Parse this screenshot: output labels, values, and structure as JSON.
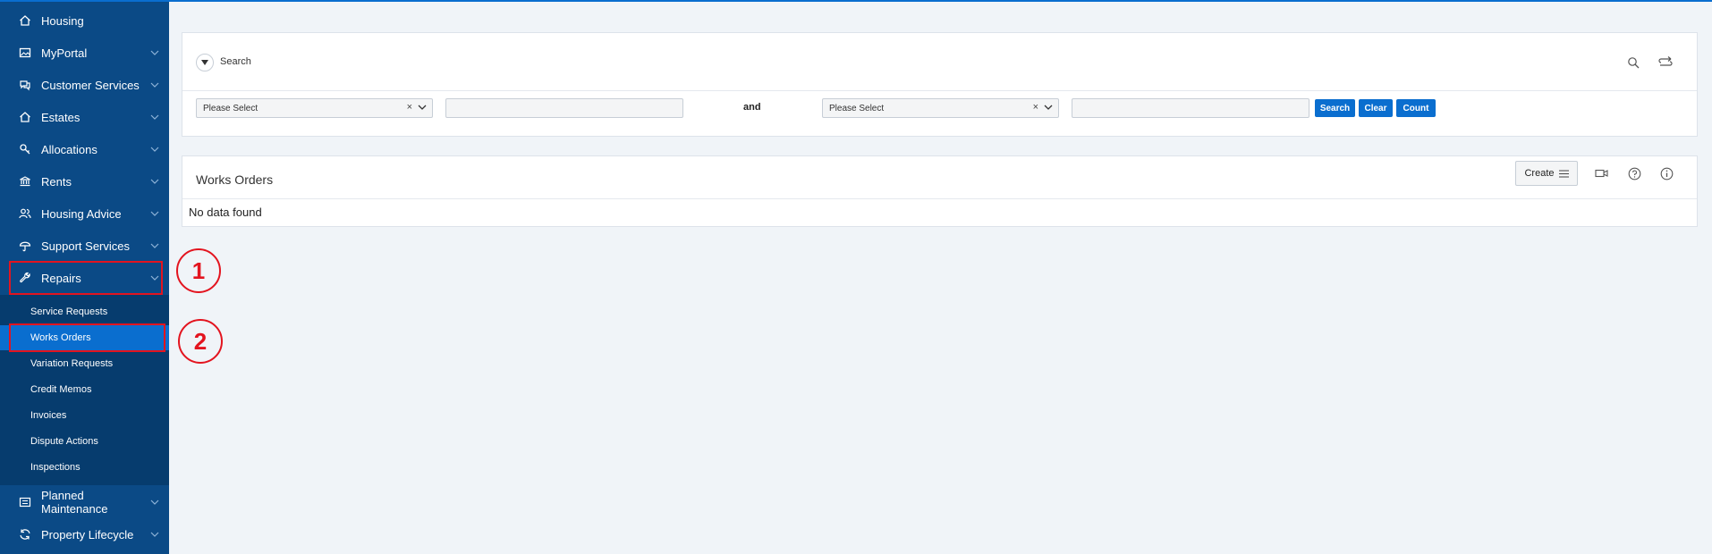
{
  "sidebar": {
    "items": [
      {
        "label": "Housing",
        "icon": "home-icon",
        "has_chevron": false
      },
      {
        "label": "MyPortal",
        "icon": "image-icon",
        "has_chevron": true
      },
      {
        "label": "Customer Services",
        "icon": "chat-icon",
        "has_chevron": true
      },
      {
        "label": "Estates",
        "icon": "home-icon",
        "has_chevron": true
      },
      {
        "label": "Allocations",
        "icon": "key-icon",
        "has_chevron": true
      },
      {
        "label": "Rents",
        "icon": "bank-icon",
        "has_chevron": true
      },
      {
        "label": "Housing Advice",
        "icon": "users-icon",
        "has_chevron": true
      },
      {
        "label": "Support Services",
        "icon": "umbrella-icon",
        "has_chevron": true
      },
      {
        "label": "Repairs",
        "icon": "wrench-icon",
        "has_chevron": true,
        "expanded": true
      }
    ],
    "repairs_sub": [
      "Service Requests",
      "Works Orders",
      "Variation Requests",
      "Credit Memos",
      "Invoices",
      "Dispute Actions",
      "Inspections"
    ],
    "active_sub": "Works Orders",
    "bottom_items": [
      {
        "label": "Planned Maintenance",
        "icon": "list-icon",
        "has_chevron": true
      },
      {
        "label": "Property Lifecycle",
        "icon": "refresh-icon",
        "has_chevron": true
      }
    ]
  },
  "annotations": {
    "step1": "1",
    "step2": "2",
    "color": "#e3141f"
  },
  "search": {
    "title": "Search",
    "select1": "Please Select",
    "select2": "Please Select",
    "clear_glyph": "×",
    "and_label": "and",
    "buttons": {
      "search": "Search",
      "clear": "Clear",
      "count": "Count"
    }
  },
  "works_orders": {
    "title": "Works Orders",
    "create_label": "Create",
    "empty_text": "No data found"
  },
  "colors": {
    "sidebar": "#0b4a86",
    "sub_panel": "#063c6e",
    "accent": "#0a6ecf",
    "background": "#f0f4f8"
  }
}
